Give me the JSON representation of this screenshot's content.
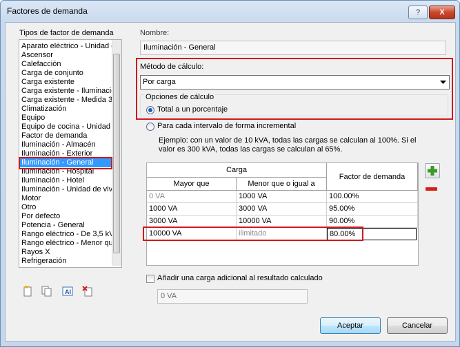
{
  "window": {
    "title": "Factores de demanda",
    "help_glyph": "?",
    "close_glyph": "X"
  },
  "left": {
    "label": "Tipos de factor de demanda",
    "items": [
      "Aparato eléctrico - Unidad d",
      "Ascensor",
      "Calefacción",
      "Carga de conjunto",
      "Carga existente",
      "Carga existente - Iluminació",
      "Carga existente - Medida 3",
      "Climatización",
      "Equipo",
      "Equipo de cocina - Unidad",
      "Factor de demanda",
      "Iluminación - Almacén",
      "Iluminación - Exterior",
      "Iluminación - General",
      "Iluminación - Hospital",
      "Iluminación - Hotel",
      "Iluminación - Unidad de viv",
      "Motor",
      "Otro",
      "Por defecto",
      "Potencia - General",
      "Rango eléctrico - De 3,5 kV",
      "Rango eléctrico - Menor qu",
      "Rayos X",
      "Refrigeración"
    ],
    "selected_index": 13,
    "toolbar_icons": [
      "new-icon",
      "duplicate-icon",
      "rename-icon",
      "delete-icon"
    ]
  },
  "right": {
    "name_label": "Nombre:",
    "name_value": "Iluminación - General",
    "method_label": "Método de cálculo:",
    "method_value": "Por carga",
    "options_label": "Opciones de cálculo",
    "radio_total": "Total a un porcentaje",
    "radio_incremental": "Para cada intervalo de forma incremental",
    "example_line1": "Ejemplo: con un valor de 10 kVA, todas las cargas se calculan al 100%. Si el",
    "example_line2": "valor es 300 kVA, todas las cargas se calculan al 65%.",
    "table": {
      "group_header": "Carga",
      "col_greater": "Mayor que",
      "col_less_equal": "Menor que o igual a",
      "col_factor": "Factor de demanda",
      "rows": [
        {
          "greater": "0 VA",
          "less": "1000 VA",
          "factor": "100.00%"
        },
        {
          "greater": "1000 VA",
          "less": "3000 VA",
          "factor": "95.00%"
        },
        {
          "greater": "3000 VA",
          "less": "10000 VA",
          "factor": "90.00%"
        },
        {
          "greater": "10000 VA",
          "less": "ilimitado",
          "factor": "80.00%"
        }
      ]
    },
    "add_row_icon": "plus-icon",
    "remove_row_icon": "minus-icon",
    "extra_load_label": "Añadir una carga adicional al resultado calculado",
    "extra_load_value": "0 VA"
  },
  "buttons": {
    "accept": "Aceptar",
    "cancel": "Cancelar"
  },
  "colors": {
    "highlight_red": "#d0181c",
    "selection_blue": "#3399ff",
    "plus_green": "#3a9a2a",
    "minus_red": "#d4201c"
  }
}
